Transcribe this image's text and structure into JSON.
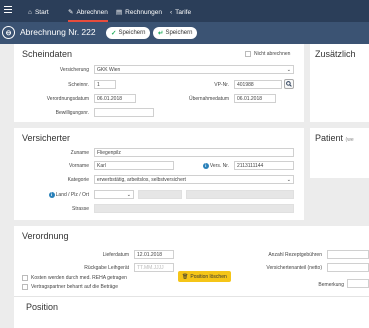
{
  "nav": {
    "items": [
      {
        "label": "Start",
        "icon": "home-icon"
      },
      {
        "label": "Abrechnen",
        "icon": "edit-icon"
      },
      {
        "label": "Rechnungen",
        "icon": "document-icon"
      },
      {
        "label": "Tarife",
        "icon": "chevron-left-icon"
      }
    ],
    "accent": "#e74c3c"
  },
  "subbar": {
    "title": "Abrechnung Nr. 222",
    "save1": "Speichern",
    "save2": "Speichern"
  },
  "scheindaten": {
    "title": "Scheindaten",
    "nicht_abrechnen": "Nicht abrechnen",
    "versicherung_label": "Versicherung",
    "versicherung_value": "GKK Wien",
    "scheinnr_label": "Scheinnr.",
    "scheinnr_value": "1",
    "vpnr_label": "VP-Nr.",
    "vpnr_value": "401988",
    "verordnungsdatum_label": "Verordnungsdatum",
    "verordnungsdatum_value": "06.01.2018",
    "uebernahmedatum_label": "Übernahmedatum",
    "uebernahmedatum_value": "06.01.2018",
    "bewilligungsnr_label": "Bewilligungsnr."
  },
  "right_top": {
    "title": "Zusätzlich"
  },
  "patient": {
    "title": "Patient",
    "suffix": "(we"
  },
  "versicherter": {
    "title": "Versicherter",
    "zuname_label": "Zuname",
    "zuname_value": "Fliegenpilz",
    "vorname_label": "Vorname",
    "vorname_value": "Karl",
    "versnr_label": "Vers. Nr.",
    "versnr_value": "2113111144",
    "kategorie_label": "Kategorie",
    "kategorie_value": "erwerbstätig, arbeitslos, selbstversichert",
    "land_label": "Land / Plz / Ort",
    "strasse_label": "Strasse"
  },
  "verordnung": {
    "title": "Verordnung",
    "lieferdatum_label": "Lieferdatum",
    "lieferdatum_value": "12.01.2018",
    "rueckgabe_label": "Rückgabe Leihgerät",
    "rueckgabe_placeholder": "TT.MM.JJJJ",
    "rezept_label": "Anzahl Rezeptgebühren",
    "selbstbehalt_label": "Versichertenanteil (netto)",
    "kosten_label": "Kosten werden durch med. REHA getragen",
    "vertrag_label": "Vertragspartner beharrt auf die Beträge",
    "bemerkung_label": "Bemerkung"
  },
  "position": {
    "title": "Position",
    "delete_label": "Position löschen"
  }
}
